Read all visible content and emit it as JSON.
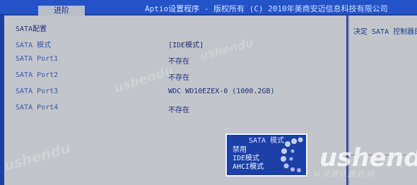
{
  "window": {
    "title": "Aptio设置程序 - 版权所有 (C) 2010年美商安迈信息科技有限公司",
    "active_tab": "进阶"
  },
  "section": {
    "title": "SATA配置"
  },
  "rows": [
    {
      "label": "SATA 模式",
      "value": "[IDE模式]"
    },
    {
      "label": "SATA Port1",
      "value": "不存在"
    },
    {
      "label": "SATA Port2",
      "value": "不存在"
    },
    {
      "label": "SATA Port3",
      "value": "WDC WD10EZEX-0 (1000.2GB)"
    },
    {
      "label": "SATA Port4",
      "value": "不存在"
    }
  ],
  "help": {
    "text": "决定 SATA 控制器的"
  },
  "popup": {
    "title": "SATA 模式",
    "options": [
      "禁用",
      "IDE模式",
      "AHCI模式"
    ]
  },
  "watermark": {
    "brand": "ushendu",
    "sub": "U深度U盘启动"
  }
}
